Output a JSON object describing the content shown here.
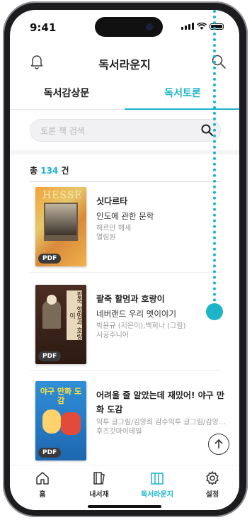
{
  "status": {
    "time": "9:41"
  },
  "header": {
    "title": "독서라운지"
  },
  "tabs": [
    {
      "label": "독서감상문"
    },
    {
      "label": "독서토론"
    }
  ],
  "search": {
    "placeholder": "토론 책 검색"
  },
  "count": {
    "prefix": "총",
    "value": "134",
    "suffix": "건"
  },
  "books": [
    {
      "title": "싯다르타",
      "subtitle": "인도에 관한 문학",
      "author": "헤르만 헤세",
      "publisher": "열림원",
      "tag": "PDF",
      "cover_text": "HESSE"
    },
    {
      "title": "팥죽 할멈과 호랑이",
      "subtitle": "네버랜드 우리 옛이야기",
      "author": "박윤규 (지은이),백희나 (그림)",
      "publisher": "시공주니어",
      "tag": "PDF",
      "cover_text": "팥죽 할멈과 호랑이"
    },
    {
      "title": "어려울 줄 알았는데 재밌어! 야구 만화 도감",
      "subtitle": "",
      "author": "익투 글그림/김양희 감수익투 글그림/김양희...",
      "publisher": "후즈갓마이테일",
      "tag": "PDF",
      "cover_text": "야구 만화 도감"
    }
  ],
  "tabbar": [
    {
      "label": "홈",
      "icon": "home-icon"
    },
    {
      "label": "내서재",
      "icon": "book-icon"
    },
    {
      "label": "독서라운지",
      "icon": "lounge-icon"
    },
    {
      "label": "설정",
      "icon": "gear-icon"
    }
  ],
  "colors": {
    "accent": "#1bb4c9"
  }
}
